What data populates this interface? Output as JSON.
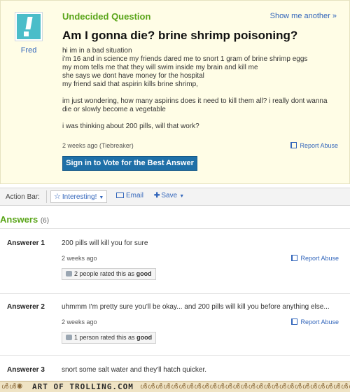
{
  "question": {
    "label": "Undecided Question",
    "show_another": "Show me another »",
    "asker": "Fred",
    "title": "Am I gonna die? brine shrimp poisoning?",
    "body_lines_1": [
      "hi im in a bad situation",
      "i'm 16 and in science my friends dared me to snort 1 gram of brine shrimp eggs",
      "my mom tells me that they will swim inside my brain and kill me",
      "she says we dont have money for the hospital",
      "my friend said that aspirin kills brine shrimp,"
    ],
    "body_lines_2": [
      "im just wondering, how many aspirins does it need to kill them all? i really dont wanna",
      "die or slowly become a vegetable"
    ],
    "body_lines_3": [
      "i was thinking about 200 pills, will that work?"
    ],
    "meta": "2 weeks ago (Tiebreaker)",
    "report_abuse": "Report Abuse",
    "sign_in_button": "Sign in to Vote for the Best Answer"
  },
  "action_bar": {
    "label": "Action Bar:",
    "interesting": "Interesting!",
    "email": "Email",
    "save": "Save"
  },
  "answers_section": {
    "heading": "Answers",
    "count": "(6)"
  },
  "answers": [
    {
      "who": "Answerer 1",
      "text": "200 pills will kill you for sure",
      "when": "2 weeks ago",
      "report": "Report Abuse",
      "rating_text": "2 people rated this as",
      "rating_word": "good"
    },
    {
      "who": "Answerer 2",
      "text": "uhmmm I'm pretty sure you'll be okay... and 200 pills will kill you before anything else...",
      "when": "2 weeks ago",
      "report": "Report Abuse",
      "rating_text": "1 person rated this as",
      "rating_word": "good"
    },
    {
      "who": "Answerer 3",
      "text": "snort some salt water and they'll hatch quicker."
    }
  ],
  "footer": {
    "brand": "ART OF TROLLING.COM"
  },
  "colors": {
    "question_bg": "#fffde6",
    "accent_green": "#5aa51a",
    "link_blue": "#3366bb",
    "button_blue": "#1f70a8"
  }
}
